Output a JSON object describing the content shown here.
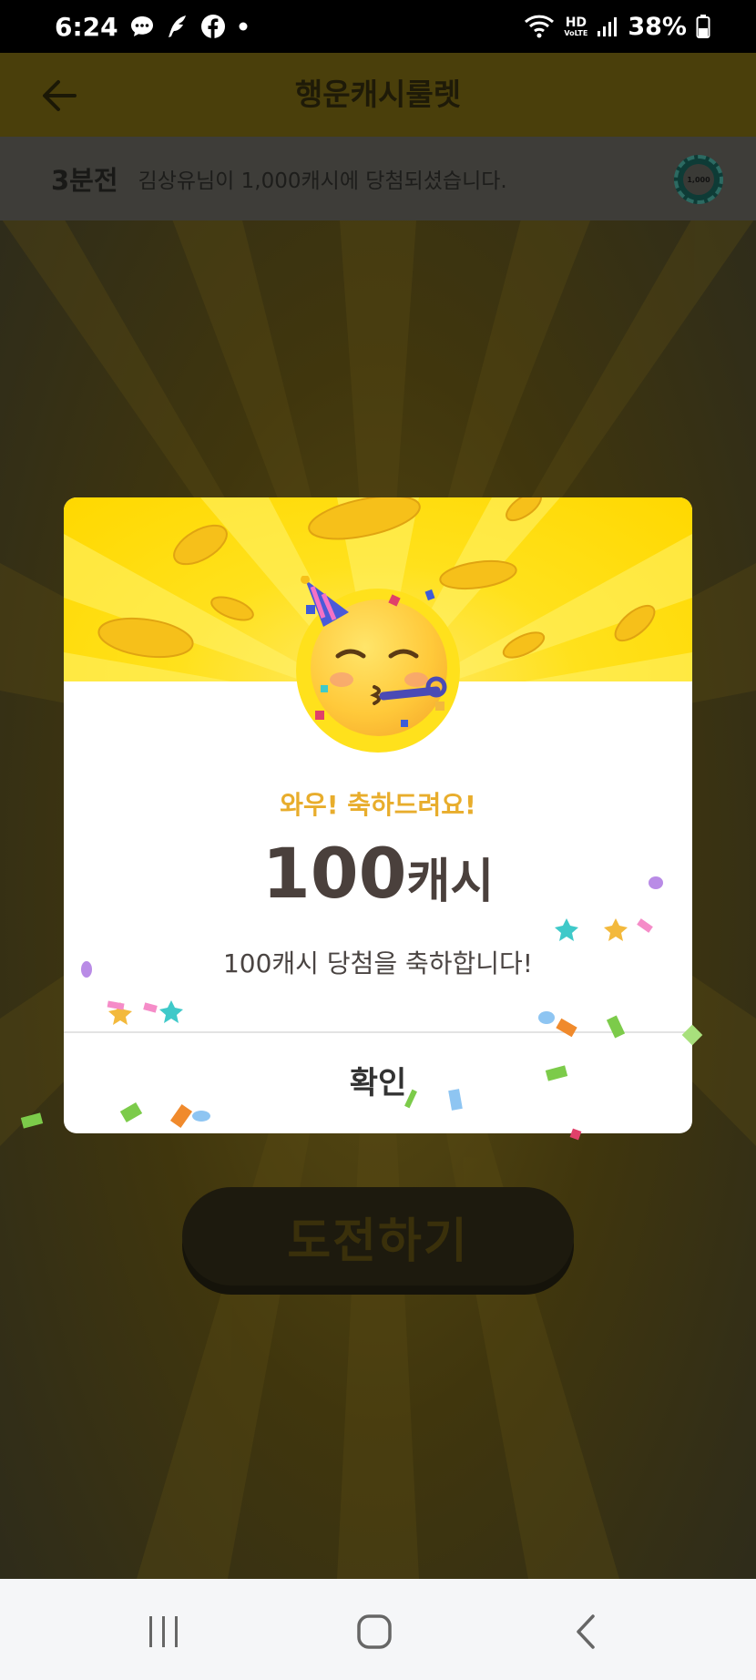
{
  "status_bar": {
    "time": "6:24",
    "battery": "38%",
    "hd_label": "HD",
    "voice_label": "VoLTE",
    "icons": [
      "chat-bubble-icon",
      "quill-icon",
      "facebook-icon",
      "dot-icon",
      "wifi-icon",
      "signal-icon",
      "battery-icon"
    ]
  },
  "app_bar": {
    "title": "행운캐시룰렛",
    "back_icon": "arrow-left-icon"
  },
  "ticker": {
    "time_ago": "3분전",
    "message": "김상유님이 1,000캐시에 당첨되셨습니다.",
    "chip_label": "1,000"
  },
  "challenge_button": {
    "label": "도전하기"
  },
  "dialog": {
    "headline": "와우! 축하드려요!",
    "amount_number": "100",
    "amount_unit": "캐시",
    "message": "100캐시 당첨을 축하합니다!",
    "confirm_label": "확인",
    "colors": {
      "headline": "#e8ad2c",
      "hero_bg": "#ffde1a",
      "coin": "#f7c21b"
    },
    "emoji_icon": "partying-face-icon"
  },
  "nav_bar": {
    "items": [
      "recent-apps-icon",
      "home-icon",
      "back-icon"
    ]
  }
}
